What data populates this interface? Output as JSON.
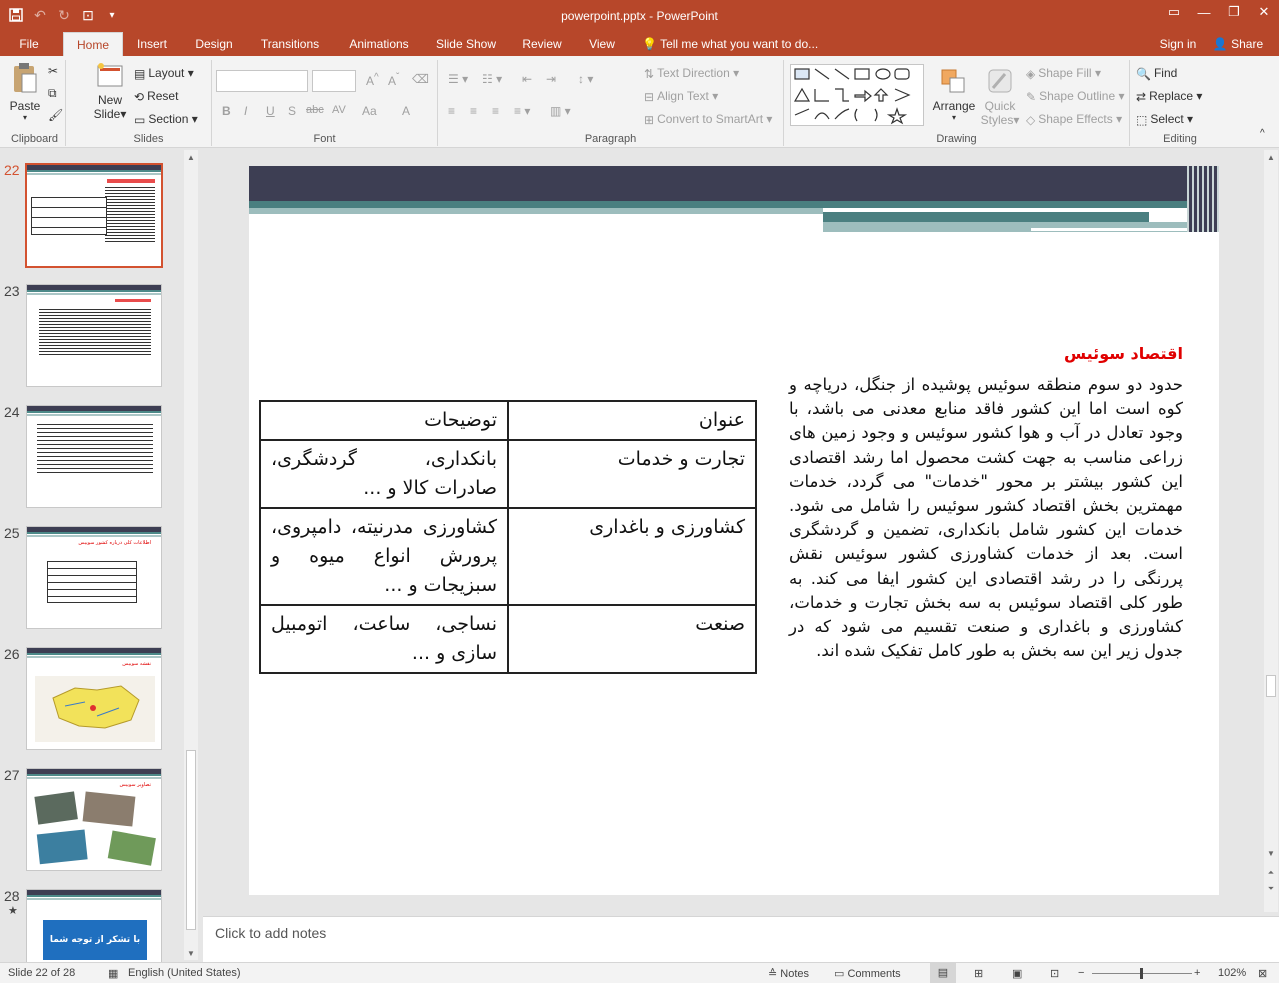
{
  "window": {
    "title": "powerpoint.pptx - PowerPoint",
    "accent": "#b7472a"
  },
  "qat": {
    "icons": [
      "save-icon",
      "undo-icon",
      "redo-icon",
      "present-icon",
      "customize-icon"
    ]
  },
  "tabs": [
    {
      "label": "File"
    },
    {
      "label": "Home"
    },
    {
      "label": "Insert"
    },
    {
      "label": "Design"
    },
    {
      "label": "Transitions"
    },
    {
      "label": "Animations"
    },
    {
      "label": "Slide Show"
    },
    {
      "label": "Review"
    },
    {
      "label": "View"
    }
  ],
  "tellme": "Tell me what you want to do...",
  "signin": "Sign in",
  "share": "Share",
  "ribbon": {
    "clipboard": {
      "label": "Clipboard",
      "paste": "Paste"
    },
    "slides": {
      "label": "Slides",
      "new_slide_1": "New",
      "new_slide_2": "Slide",
      "layout": "Layout",
      "reset": "Reset",
      "section": "Section"
    },
    "font": {
      "label": "Font",
      "b": "B",
      "i": "I",
      "u": "U",
      "s": "S",
      "abc": "abc",
      "av": "AV",
      "aa": "Aa",
      "a": "A"
    },
    "paragraph": {
      "label": "Paragraph",
      "text_direction": "Text Direction",
      "align_text": "Align Text",
      "convert_smartart": "Convert to SmartArt"
    },
    "drawing": {
      "label": "Drawing",
      "arrange": "Arrange",
      "quick_styles_1": "Quick",
      "quick_styles_2": "Styles",
      "shape_fill": "Shape Fill",
      "shape_outline": "Shape Outline",
      "shape_effects": "Shape Effects"
    },
    "editing": {
      "label": "Editing",
      "find": "Find",
      "replace": "Replace",
      "select": "Select"
    }
  },
  "thumbnails": [
    {
      "num": "22",
      "selected": true
    },
    {
      "num": "23"
    },
    {
      "num": "24"
    },
    {
      "num": "25",
      "title": "اطلاعات کلی درباره کشور سوییس"
    },
    {
      "num": "26",
      "title": "نقشه سوییس"
    },
    {
      "num": "27",
      "title": "تصاویر سوییس"
    },
    {
      "num": "28",
      "star": "★",
      "banner": "با تشکر از توجه شما"
    }
  ],
  "slide": {
    "title": "اقتصاد سوئیس",
    "body": "حدود دو سوم منطقه سوئیس پوشیده از جنگل، دریاچه و کوه است اما این کشور فاقد منابع معدنی می باشد، با وجود تعادل در آب و هوا کشور سوئیس و وجود زمین های زراعی مناسب به جهت کشت محصول اما رشد اقتصادی این کشور بیشتر بر محور \"خدمات\" می گردد، خدمات مهمترین بخش اقتصاد کشور سوئیس را شامل می شود. خدمات این کشور شامل بانکداری، تضمین و گردشگری است. بعد از خدمات کشاورزی کشور سوئیس نقش پررنگی را در رشد اقتصادی این کشور ایفا می کند. به طور کلی اقتصاد سوئیس به سه بخش تجارت و خدمات، کشاورزی و باغداری و صنعت تقسیم می شود که در جدول زیر این سه بخش به طور کامل تفکیک شده اند.",
    "table": {
      "headers": [
        "عنوان",
        "توضیحات"
      ],
      "rows": [
        [
          "تجارت و خدمات",
          "بانکداری، گردشگری، صادرات کالا و ..."
        ],
        [
          "کشاورزی و باغداری",
          "کشاورزی مدرنیته، دامپروی، پرورش انواع میوه و سبزیجات و ..."
        ],
        [
          "صنعت",
          "نساجی، ساعت، اتومبیل سازی و ..."
        ]
      ]
    }
  },
  "notes_placeholder": "Click to add notes",
  "status": {
    "slide": "Slide 22 of 28",
    "language": "English (United States)",
    "notes": "Notes",
    "comments": "Comments",
    "zoom": "102%"
  }
}
